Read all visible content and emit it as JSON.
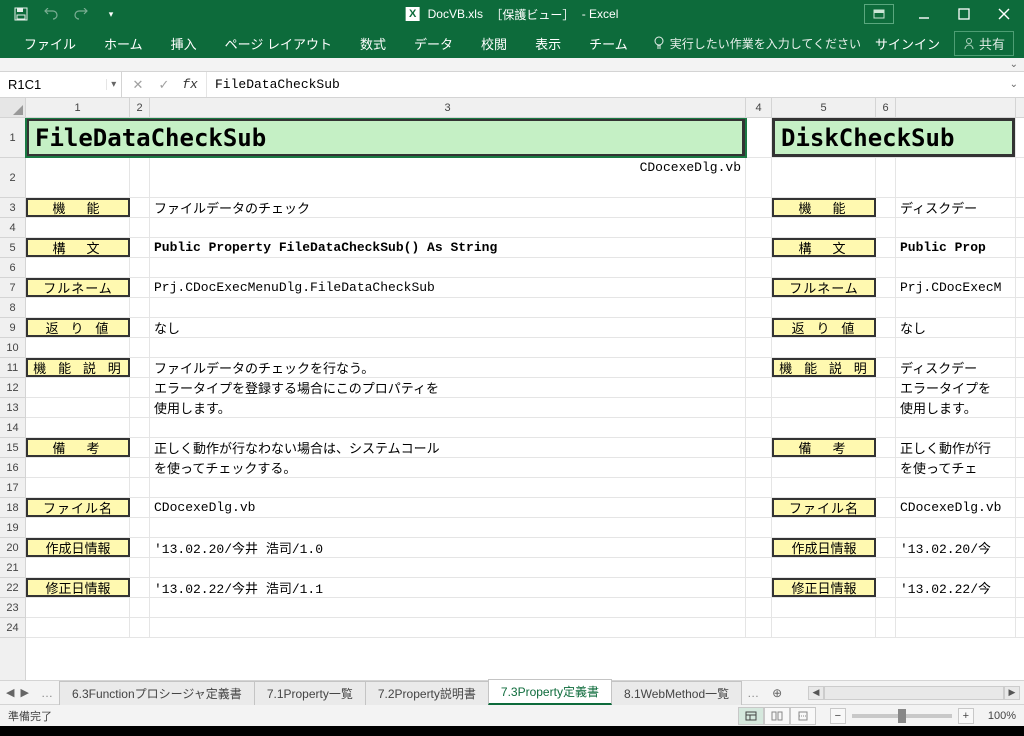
{
  "window": {
    "title_doc": "DocVB.xls",
    "title_mode": "［保護ビュー］",
    "title_app": "- Excel"
  },
  "ribbon": {
    "tabs": [
      "ファイル",
      "ホーム",
      "挿入",
      "ページ レイアウト",
      "数式",
      "データ",
      "校閲",
      "表示",
      "チーム"
    ],
    "tellme": "実行したい作業を入力してください",
    "signin": "サインイン",
    "share": "共有"
  },
  "formula_bar": {
    "name_box": "R1C1",
    "formula": "FileDataCheckSub"
  },
  "columns": [
    "1",
    "2",
    "3",
    "4",
    "5",
    "6"
  ],
  "rows": [
    "1",
    "2",
    "3",
    "4",
    "5",
    "6",
    "7",
    "8",
    "9",
    "10",
    "11",
    "12",
    "13",
    "14",
    "15",
    "16",
    "17",
    "18",
    "19",
    "20",
    "21",
    "22",
    "23",
    "24"
  ],
  "left_block": {
    "heading": "FileDataCheckSub",
    "src_file": "CDocexeDlg.vb",
    "labels": {
      "kinou": "機　能",
      "koubun": "構　文",
      "fullname": "フルネーム",
      "return": "返 り 値",
      "setsumei": "機 能 説 明",
      "bikou": "備　考",
      "filename": "ファイル名",
      "created": "作成日情報",
      "modified": "修正日情報"
    },
    "values": {
      "kinou": "ファイルデータのチェック",
      "koubun": "Public Property FileDataCheckSub() As String",
      "fullname": "Prj.CDocExecMenuDlg.FileDataCheckSub",
      "return": "なし",
      "setsumei1": "ファイルデータのチェックを行なう。",
      "setsumei2": "エラータイプを登録する場合にこのプロパティを",
      "setsumei3": "使用します。",
      "bikou1": "正しく動作が行なわない場合は、システムコール",
      "bikou2": "を使ってチェックする。",
      "filename": "CDocexeDlg.vb",
      "created": "'13.02.20/今井 浩司/1.0",
      "modified": "'13.02.22/今井 浩司/1.1"
    }
  },
  "right_block": {
    "heading": "DiskCheckSub",
    "labels": {
      "kinou": "機　能",
      "koubun": "構　文",
      "fullname": "フルネーム",
      "return": "返 り 値",
      "setsumei": "機 能 説 明",
      "bikou": "備　考",
      "filename": "ファイル名",
      "created": "作成日情報",
      "modified": "修正日情報"
    },
    "values": {
      "kinou": "ディスクデー",
      "koubun": "Public Prop",
      "fullname": "Prj.CDocExecM",
      "return": "なし",
      "setsumei1": "ディスクデー",
      "setsumei2": "エラータイプを",
      "setsumei3": "使用します。",
      "bikou1": "正しく動作が行",
      "bikou2": "を使ってチェ",
      "filename": "CDocexeDlg.vb",
      "created": "'13.02.20/今",
      "modified": "'13.02.22/今"
    }
  },
  "sheet_tabs": {
    "visible": [
      "6.3Functionプロシージャ定義書",
      "7.1Property一覧",
      "7.2Property説明書",
      "7.3Property定義書",
      "8.1WebMethod一覧"
    ],
    "active_index": 3
  },
  "statusbar": {
    "ready": "準備完了",
    "zoom": "100%"
  }
}
